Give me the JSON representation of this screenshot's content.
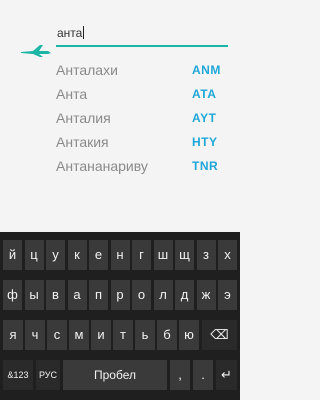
{
  "search": {
    "query": "анта",
    "icon": "airplane-icon",
    "accent_color": "#1bb5a6"
  },
  "results": [
    {
      "city": "Анталахи",
      "code": "ANM"
    },
    {
      "city": "Анта",
      "code": "ATA"
    },
    {
      "city": "Анталия",
      "code": "AYT"
    },
    {
      "city": "Антакия",
      "code": "HTY"
    },
    {
      "city": "Антананариву",
      "code": "TNR"
    }
  ],
  "keyboard": {
    "row1": [
      "й",
      "ц",
      "у",
      "к",
      "е",
      "н",
      "г",
      "ш",
      "щ",
      "з",
      "х"
    ],
    "row2": [
      "ф",
      "ы",
      "в",
      "а",
      "п",
      "р",
      "о",
      "л",
      "д",
      "ж",
      "э"
    ],
    "row3": [
      "я",
      "ч",
      "с",
      "м",
      "и",
      "т",
      "ь",
      "б",
      "ю",
      "⌫"
    ],
    "row4": [
      "&123",
      "РУС",
      "Пробел",
      ",",
      ".",
      "↵"
    ]
  },
  "colors": {
    "code_color": "#1ea7d8",
    "keyboard_bg": "#1f1f1f",
    "key_bg": "#3a3a3a"
  }
}
